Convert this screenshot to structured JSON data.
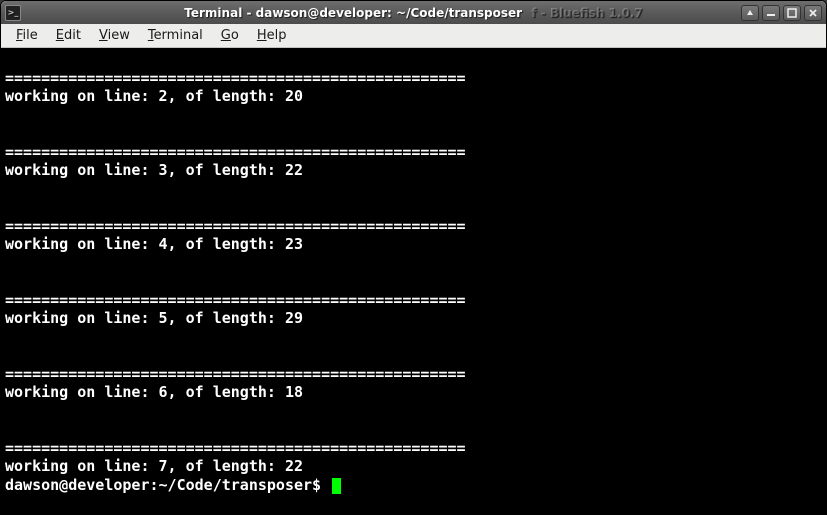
{
  "titlebar": {
    "title": "Terminal - dawson@developer: ~/Code/transposer",
    "background_app_hint": "f - Bluefish 1.0.7"
  },
  "menubar": {
    "file": "File",
    "edit": "Edit",
    "view": "View",
    "terminal": "Terminal",
    "go": "Go",
    "help": "Help"
  },
  "terminal": {
    "sep": "===================================================",
    "lines": [
      {
        "n": 2,
        "len": 20
      },
      {
        "n": 3,
        "len": 22
      },
      {
        "n": 4,
        "len": 23
      },
      {
        "n": 5,
        "len": 29
      },
      {
        "n": 6,
        "len": 18
      },
      {
        "n": 7,
        "len": 22
      }
    ],
    "prompt": "dawson@developer:~/Code/transposer$ "
  }
}
